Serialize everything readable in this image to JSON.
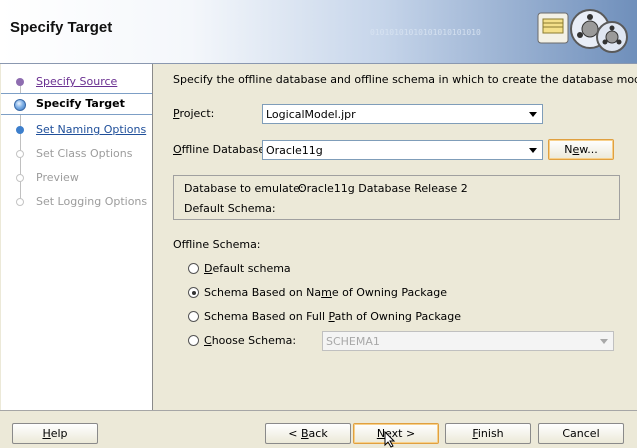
{
  "header": {
    "title": "Specify Target",
    "bits": "01010101010101010101010"
  },
  "nav": {
    "items": [
      {
        "label": "Specify Source",
        "state": "visited"
      },
      {
        "label": "Specify Target",
        "state": "current"
      },
      {
        "label": "Set Naming Options",
        "state": "link"
      },
      {
        "label": "Set Class Options",
        "state": "disabled"
      },
      {
        "label": "Preview",
        "state": "disabled"
      },
      {
        "label": "Set Logging Options",
        "state": "disabled"
      }
    ]
  },
  "main": {
    "intro": "Specify the offline database and offline schema in which to create the database model.",
    "project": {
      "label_pre": "",
      "label_mn": "P",
      "label_post": "roject:",
      "value": "LogicalModel.jpr"
    },
    "offline_database": {
      "label_mn": "O",
      "label_post": "ffline Database:",
      "value": "Oracle11g"
    },
    "new_button": {
      "pre": "N",
      "mn": "e",
      "post": "w..."
    },
    "info": {
      "emulate_label": "Database to emulate:",
      "emulate_value": "Oracle11g Database Release 2",
      "schema_label": "Default Schema:",
      "schema_value": ""
    },
    "offline_schema_label": "Offline Schema:",
    "radios": {
      "default": {
        "pre": "",
        "mn": "D",
        "post": "efault schema",
        "checked": false
      },
      "owning_package": {
        "pre": "Schema Based on Na",
        "mn": "m",
        "post": "e of Owning Package",
        "checked": true
      },
      "full_path": {
        "pre": "Schema Based on Full ",
        "mn": "P",
        "post": "ath of Owning Package",
        "checked": false
      },
      "choose": {
        "pre": "",
        "mn": "C",
        "post": "hoose Schema:",
        "checked": false
      }
    },
    "choose_schema_value": "SCHEMA1"
  },
  "footer": {
    "help": {
      "mn": "H",
      "post": "elp"
    },
    "back": {
      "pre": "< ",
      "mn": "B",
      "post": "ack"
    },
    "next": {
      "pre": "",
      "mn": "N",
      "post": "ext >"
    },
    "finish": {
      "mn": "F",
      "post": "inish"
    },
    "cancel": "Cancel"
  },
  "colors": {
    "visited": "#6a2f91",
    "link": "#1f4f9a",
    "disabled": "#9c9c9c",
    "focus_border": "#e0a040"
  }
}
